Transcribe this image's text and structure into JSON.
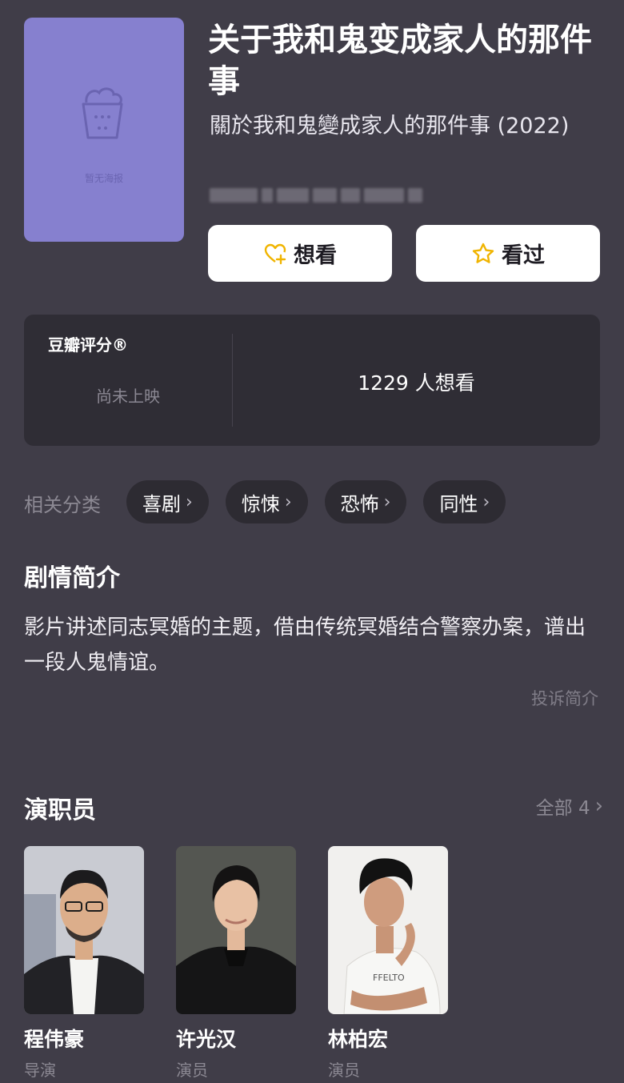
{
  "poster": {
    "caption": "暂无海报",
    "icon": "popcorn-icon",
    "color": "#8680cf"
  },
  "movie": {
    "title": "关于我和鬼变成家人的那件事",
    "original_title": "關於我和鬼變成家人的那件事",
    "year": "(2022)"
  },
  "actions": {
    "want_label": "想看",
    "want_icon": "heart-plus-icon",
    "seen_label": "看过",
    "seen_icon": "star-icon",
    "accent": "#f0b400"
  },
  "rating": {
    "label": "豆瓣评分®",
    "status": "尚未上映",
    "want_count": "1229 人想看"
  },
  "categories": {
    "label": "相关分类",
    "tags": [
      "喜剧",
      "惊悚",
      "恐怖",
      "同性"
    ]
  },
  "synopsis": {
    "heading": "剧情简介",
    "text": "影片讲述同志冥婚的主题，借由传统冥婚结合警察办案，谱出一段人鬼情谊。",
    "report_label": "投诉简介"
  },
  "cast": {
    "heading": "演职员",
    "see_all": "全部 4",
    "members": [
      {
        "name": "程伟豪",
        "role": "导演"
      },
      {
        "name": "许光汉",
        "role": "演员"
      },
      {
        "name": "林柏宏",
        "role": "演员"
      }
    ]
  }
}
